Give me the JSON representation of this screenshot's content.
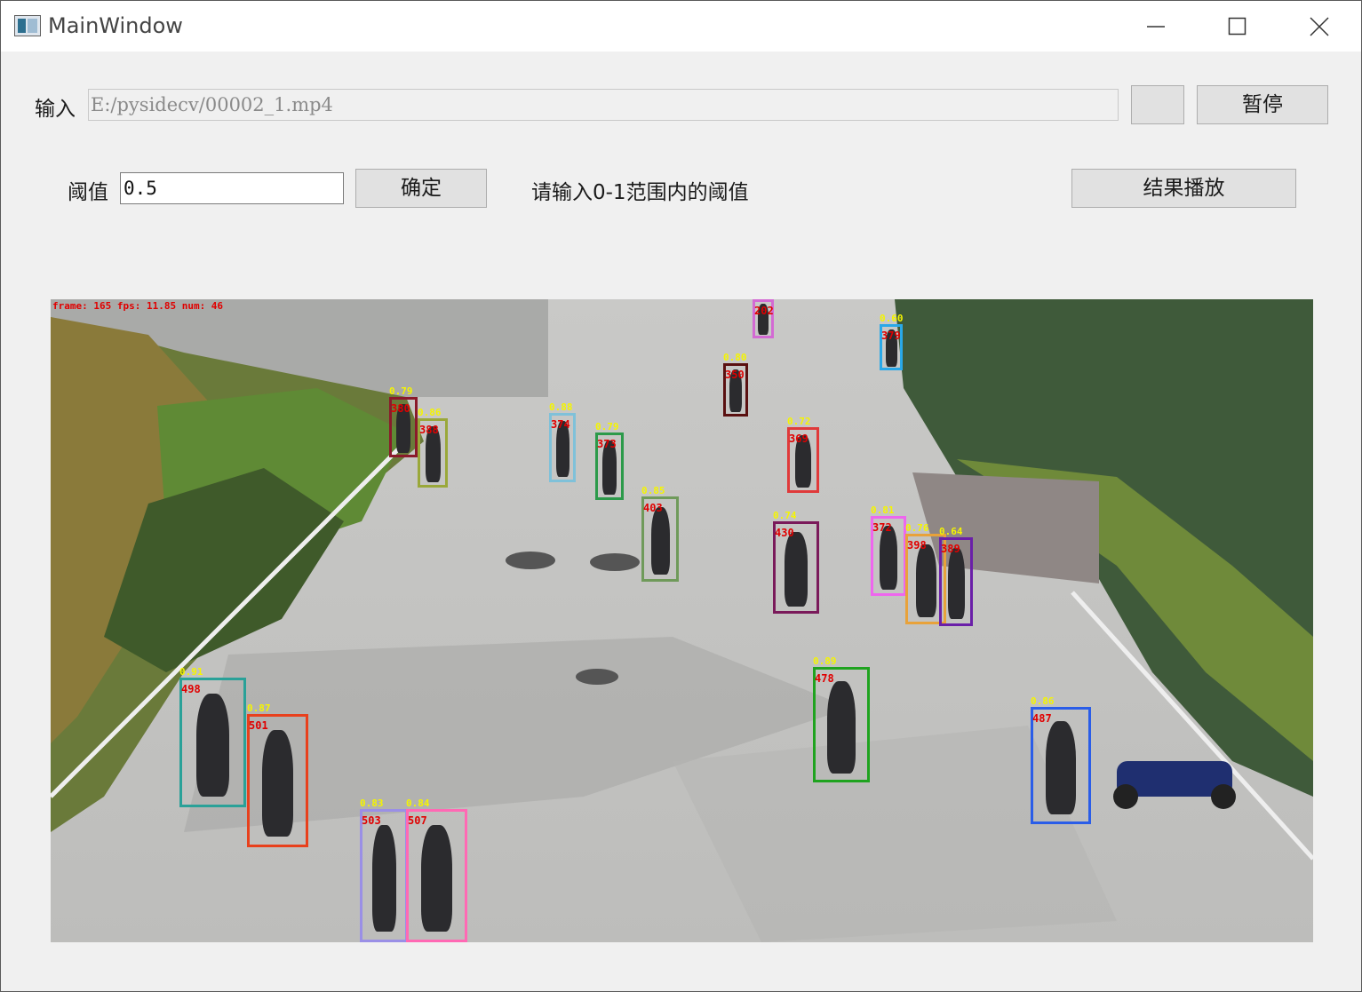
{
  "window": {
    "title": "MainWindow"
  },
  "input_row": {
    "label": "输入",
    "path_value": "E:/pysidecv/00002_1.mp4",
    "browse_label": "",
    "pause_label": "暂停"
  },
  "threshold_row": {
    "label": "阈值",
    "value": "0.5",
    "confirm_label": "确定",
    "hint": "请输入0-1范围内的阈值",
    "play_label": "结果播放"
  },
  "video": {
    "overlay_text": "frame: 165  fps: 11.85  num: 46",
    "detections": [
      {
        "id": "498",
        "conf": "0.91",
        "color": "#2aa198"
      },
      {
        "id": "501",
        "conf": "0.87",
        "color": "#e8401c"
      },
      {
        "id": "503",
        "conf": "0.83",
        "color": "#9a8fe6"
      },
      {
        "id": "507",
        "conf": "0.84",
        "color": "#ff69b4"
      },
      {
        "id": "478",
        "conf": "0.89",
        "color": "#1fa31f"
      },
      {
        "id": "487",
        "conf": "0.86",
        "color": "#2a5de8"
      },
      {
        "id": "403",
        "conf": "0.85",
        "color": "#6f9a5a"
      },
      {
        "id": "380",
        "conf": "0.79",
        "color": "#8b1a2b"
      },
      {
        "id": "388",
        "conf": "0.86",
        "color": "#9aa83a"
      },
      {
        "id": "374",
        "conf": "0.88",
        "color": "#7fc1d9"
      },
      {
        "id": "373",
        "conf": "0.79",
        "color": "#2c9a4a"
      },
      {
        "id": "369",
        "conf": "0.72",
        "color": "#e03a3a"
      },
      {
        "id": "372",
        "conf": "0.81",
        "color": "#ee66ee"
      },
      {
        "id": "398",
        "conf": "0.76",
        "color": "#e8a23a"
      },
      {
        "id": "389",
        "conf": "0.64",
        "color": "#6a1fa8"
      },
      {
        "id": "430",
        "conf": "0.74",
        "color": "#7a1a5a"
      },
      {
        "id": "379",
        "conf": "0.60",
        "color": "#2aa8e8"
      },
      {
        "id": "350",
        "conf": "0.80",
        "color": "#5a1010"
      },
      {
        "id": "202",
        "conf": "",
        "color": "#d36ad3"
      }
    ]
  }
}
